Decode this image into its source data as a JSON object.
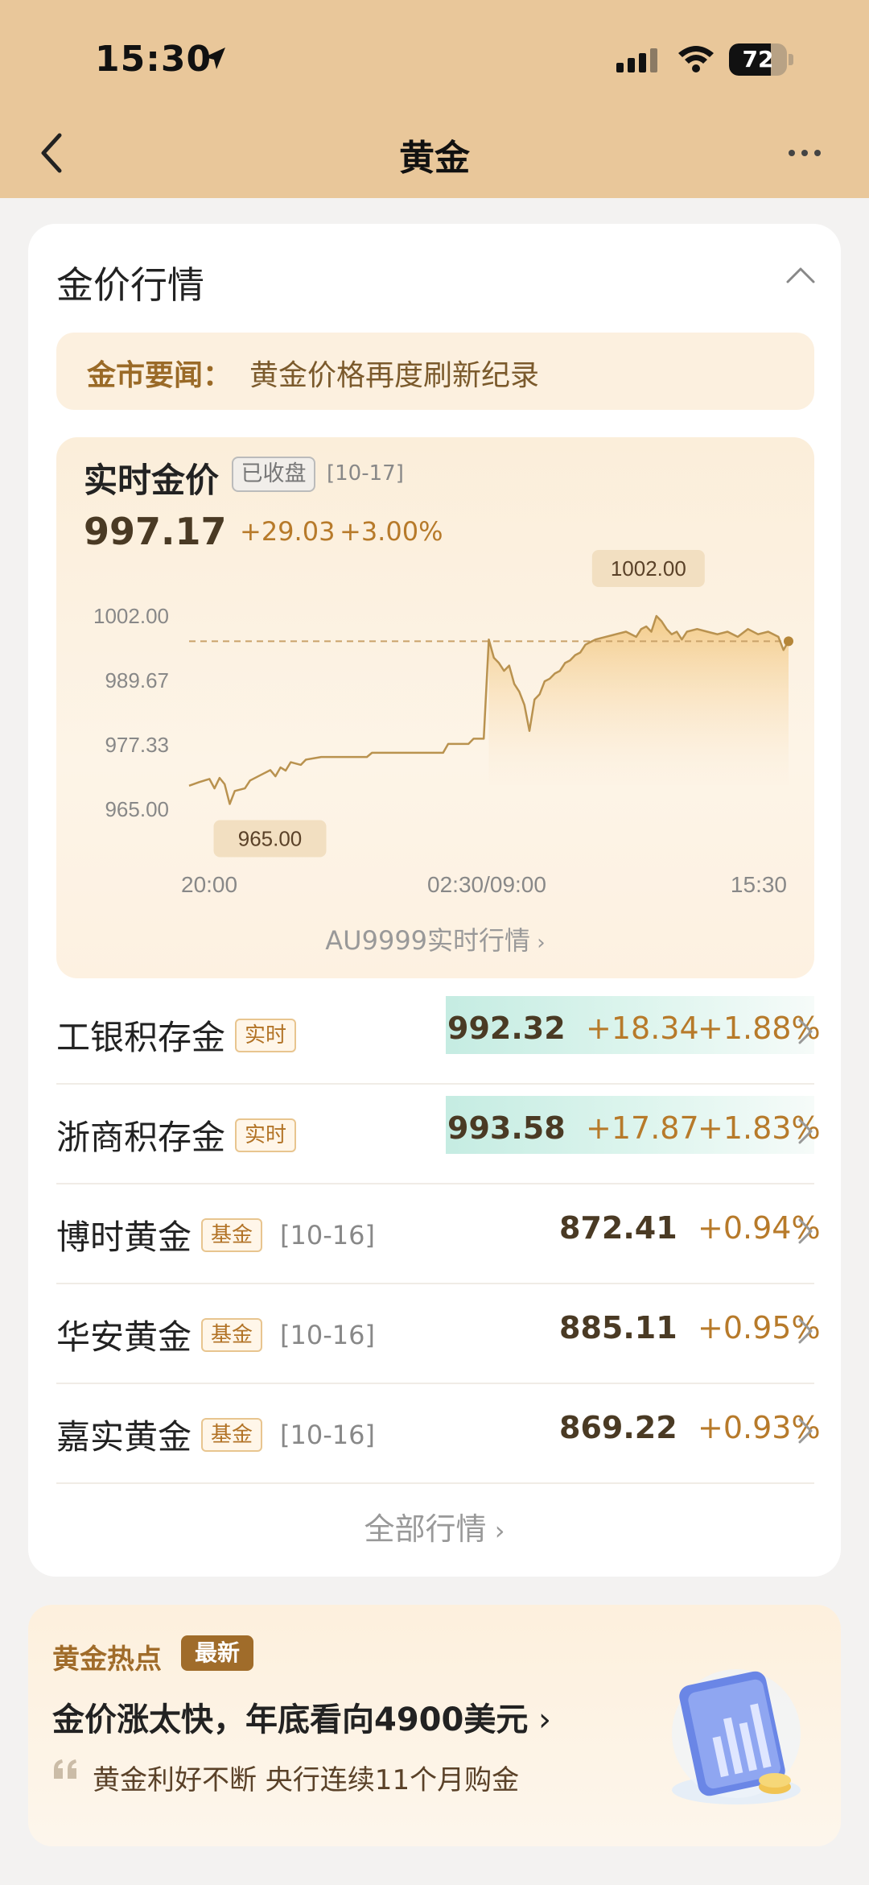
{
  "status": {
    "time": "15:30",
    "battery": "72",
    "battery_level": 0.72
  },
  "nav": {
    "title": "黄金"
  },
  "section": {
    "title": "金价行情"
  },
  "news": {
    "label": "金市要闻：",
    "text": "黄金价格再度刷新纪录"
  },
  "realtime": {
    "title": "实时金价",
    "badge": "已收盘",
    "date": "[10-17]",
    "price": "997.17",
    "change": "+29.03",
    "percent": "+3.00%",
    "link": "AU9999实时行情",
    "high_label": "1002.00",
    "low_label": "965.00"
  },
  "chart_data": {
    "type": "line",
    "y_ticks": [
      "1002.00",
      "989.67",
      "977.33",
      "965.00"
    ],
    "x_ticks": [
      "20:00",
      "02:30/09:00",
      "15:30"
    ],
    "ylim": [
      965.0,
      1002.0
    ],
    "reference_line": 997.17,
    "series": [
      {
        "points": [
          [
            0,
            969.5
          ],
          [
            2,
            970.2
          ],
          [
            4,
            970.8
          ],
          [
            5,
            969.0
          ],
          [
            6,
            971.0
          ],
          [
            7,
            969.8
          ],
          [
            8,
            966.0
          ],
          [
            9,
            968.5
          ],
          [
            11,
            969.0
          ],
          [
            12,
            970.5
          ],
          [
            14,
            971.5
          ],
          [
            16,
            972.5
          ],
          [
            17,
            971.3
          ],
          [
            18,
            973.0
          ],
          [
            19,
            972.4
          ],
          [
            20,
            974.0
          ],
          [
            22,
            973.5
          ],
          [
            23,
            974.5
          ],
          [
            26,
            975.0
          ],
          [
            35,
            975.0
          ],
          [
            36,
            975.8
          ],
          [
            50,
            975.8
          ],
          [
            51,
            977.5
          ],
          [
            55,
            977.5
          ],
          [
            56,
            978.5
          ],
          [
            58,
            978.5
          ],
          [
            59,
            997.5
          ],
          [
            60,
            994.0
          ],
          [
            61,
            993.0
          ],
          [
            62,
            991.5
          ],
          [
            63,
            992.5
          ],
          [
            64,
            989.0
          ],
          [
            65,
            987.5
          ],
          [
            66,
            985.0
          ],
          [
            67,
            980.0
          ],
          [
            68,
            986.0
          ],
          [
            69,
            987.0
          ],
          [
            70,
            989.5
          ],
          [
            71,
            990.0
          ],
          [
            72,
            991.0
          ],
          [
            73,
            991.5
          ],
          [
            74,
            993.0
          ],
          [
            75,
            993.5
          ],
          [
            76,
            994.5
          ],
          [
            77,
            995.0
          ],
          [
            78,
            996.5
          ],
          [
            79,
            997.0
          ],
          [
            80,
            997.5
          ],
          [
            82,
            998.0
          ],
          [
            84,
            998.5
          ],
          [
            86,
            999.0
          ],
          [
            88,
            998.0
          ],
          [
            89,
            999.5
          ],
          [
            90,
            1000.0
          ],
          [
            91,
            999.0
          ],
          [
            92,
            1002.0
          ],
          [
            93,
            1001.0
          ],
          [
            94,
            999.5
          ],
          [
            95,
            998.5
          ],
          [
            96,
            999.0
          ],
          [
            97,
            997.5
          ],
          [
            98,
            999.0
          ],
          [
            100,
            999.5
          ],
          [
            102,
            999.0
          ],
          [
            104,
            998.5
          ],
          [
            106,
            999.0
          ],
          [
            108,
            998.0
          ],
          [
            110,
            999.5
          ],
          [
            112,
            998.5
          ],
          [
            114,
            999.0
          ],
          [
            116,
            998.0
          ],
          [
            117,
            995.5
          ],
          [
            118,
            997.17
          ]
        ],
        "color": "#b9924f"
      }
    ]
  },
  "rows": [
    {
      "name": "工银积存金",
      "badge": "实时",
      "date": "",
      "price": "992.32",
      "change": "+18.34",
      "percent": "+1.88%",
      "highlight": true
    },
    {
      "name": "浙商积存金",
      "badge": "实时",
      "date": "",
      "price": "993.58",
      "change": "+17.87",
      "percent": "+1.83%",
      "highlight": true
    },
    {
      "name": "博时黄金",
      "badge": "基金",
      "date": "[10-16]",
      "price": "872.41",
      "change": "",
      "percent": "+0.94%",
      "highlight": false
    },
    {
      "name": "华安黄金",
      "badge": "基金",
      "date": "[10-16]",
      "price": "885.11",
      "change": "",
      "percent": "+0.95%",
      "highlight": false
    },
    {
      "name": "嘉实黄金",
      "badge": "基金",
      "date": "[10-16]",
      "price": "869.22",
      "change": "",
      "percent": "+0.93%",
      "highlight": false
    }
  ],
  "all_link": "全部行情",
  "hot": {
    "title": "黄金热点",
    "badge": "最新",
    "headline": "金价涨太快，年底看向4900美元",
    "sub": "黄金利好不断 央行连续11个月购金"
  },
  "colors": {
    "accent": "#b77a2a",
    "topbar": "#e9c79a"
  }
}
